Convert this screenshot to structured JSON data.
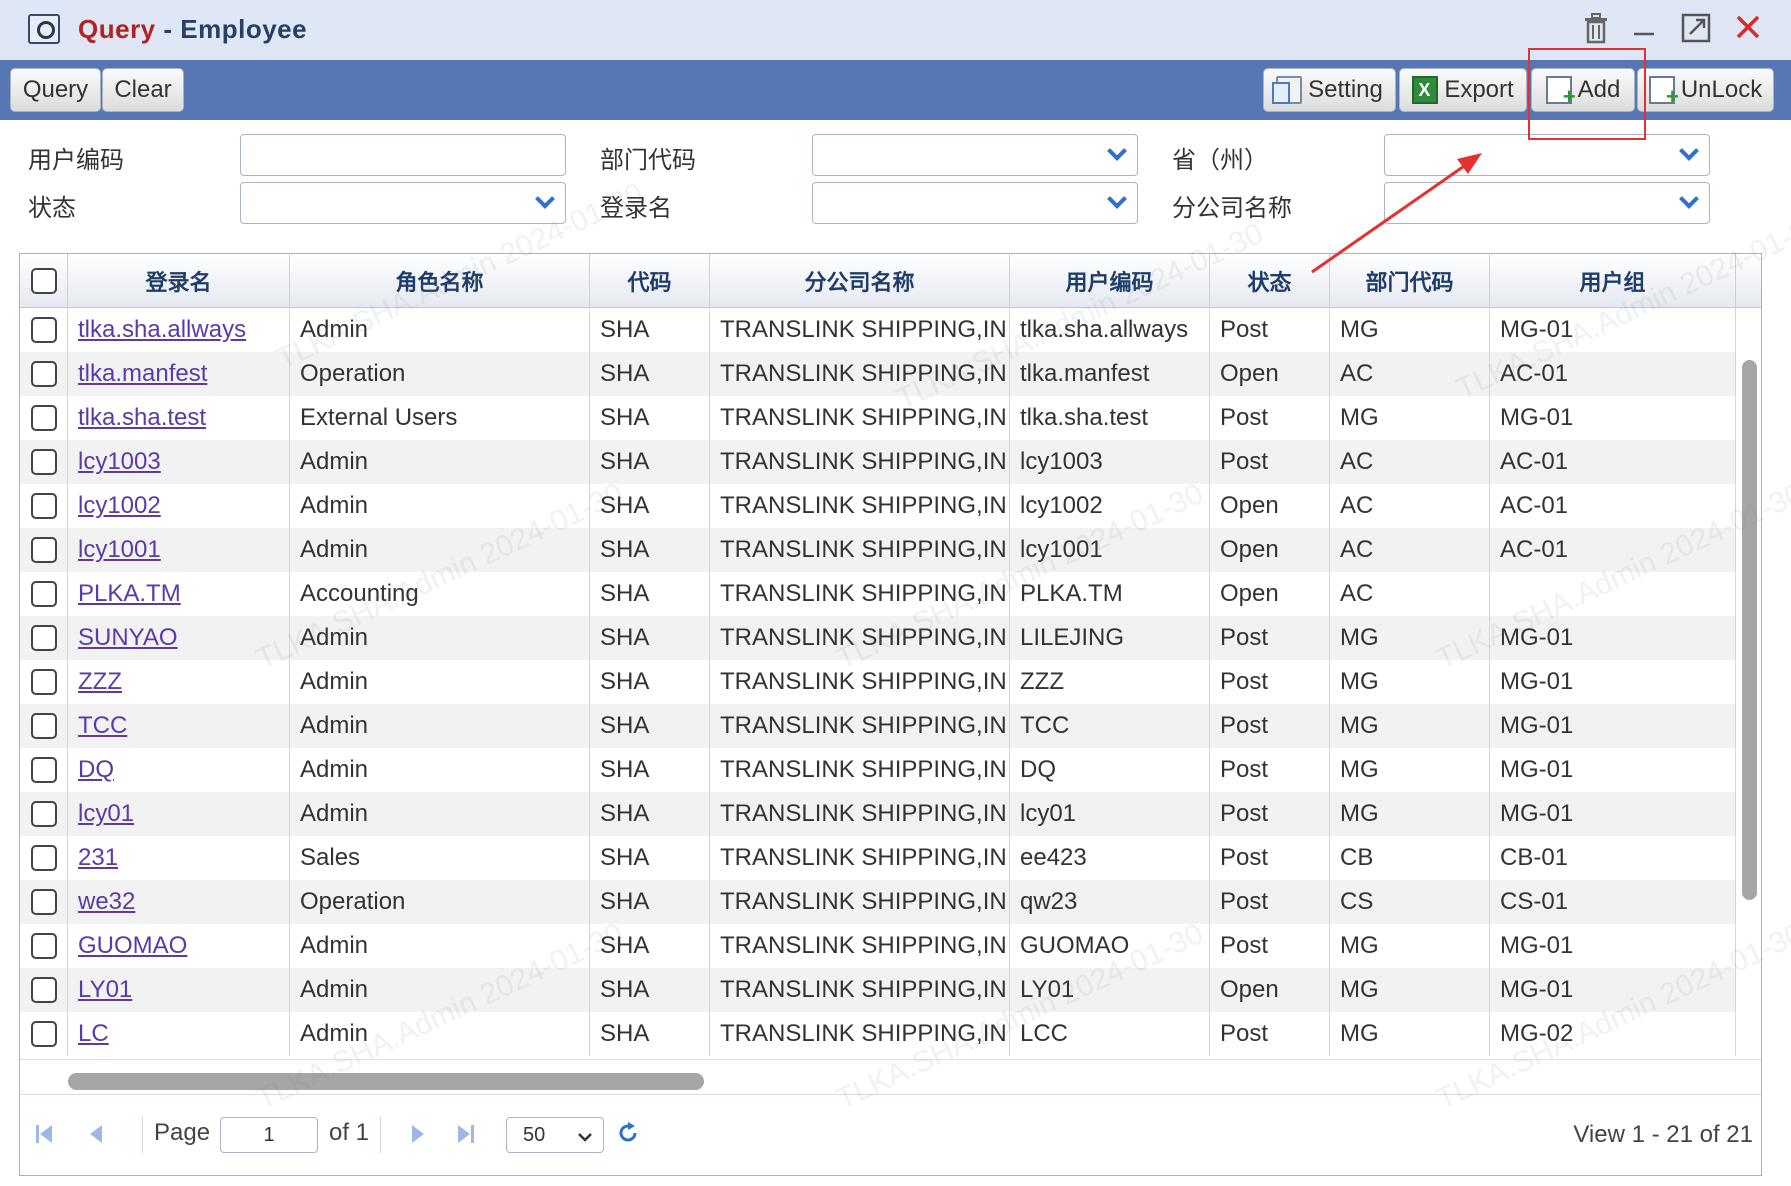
{
  "window": {
    "title_prefix": "Query",
    "title_sep": " - ",
    "title_name": "Employee",
    "controls": {
      "delete": "🗑",
      "minimize": "–",
      "maximize": "⤢",
      "close": "✕"
    }
  },
  "toolbar": {
    "query": "Query",
    "clear": "Clear",
    "setting": "Setting",
    "export": "Export",
    "add": "Add",
    "unlock": "UnLock"
  },
  "form": {
    "user_code": "用户编码",
    "dept_code": "部门代码",
    "province": "省（州）",
    "status": "状态",
    "login_name": "登录名",
    "branch_name": "分公司名称"
  },
  "grid": {
    "columns": [
      "登录名",
      "角色名称",
      "代码",
      "分公司名称",
      "用户编码",
      "状态",
      "部门代码",
      "用户组"
    ],
    "rows": [
      [
        "tlka.sha.allways",
        "Admin",
        "SHA",
        "TRANSLINK SHIPPING,IN",
        "tlka.sha.allways",
        "Post",
        "MG",
        "MG-01"
      ],
      [
        "tlka.manfest",
        "Operation",
        "SHA",
        "TRANSLINK SHIPPING,IN",
        "tlka.manfest",
        "Open",
        "AC",
        "AC-01"
      ],
      [
        "tlka.sha.test",
        "External Users",
        "SHA",
        "TRANSLINK SHIPPING,IN",
        "tlka.sha.test",
        "Post",
        "MG",
        "MG-01"
      ],
      [
        "lcy1003",
        "Admin",
        "SHA",
        "TRANSLINK SHIPPING,IN",
        "lcy1003",
        "Post",
        "AC",
        "AC-01"
      ],
      [
        "lcy1002",
        "Admin",
        "SHA",
        "TRANSLINK SHIPPING,IN",
        "lcy1002",
        "Open",
        "AC",
        "AC-01"
      ],
      [
        "lcy1001",
        "Admin",
        "SHA",
        "TRANSLINK SHIPPING,IN",
        "lcy1001",
        "Open",
        "AC",
        "AC-01"
      ],
      [
        "PLKA.TM",
        "Accounting",
        "SHA",
        "TRANSLINK SHIPPING,IN",
        "PLKA.TM",
        "Open",
        "AC",
        ""
      ],
      [
        "SUNYAO",
        "Admin",
        "SHA",
        "TRANSLINK SHIPPING,IN",
        "LILEJING",
        "Post",
        "MG",
        "MG-01"
      ],
      [
        "ZZZ",
        "Admin",
        "SHA",
        "TRANSLINK SHIPPING,IN",
        "ZZZ",
        "Post",
        "MG",
        "MG-01"
      ],
      [
        "TCC",
        "Admin",
        "SHA",
        "TRANSLINK SHIPPING,IN",
        "TCC",
        "Post",
        "MG",
        "MG-01"
      ],
      [
        "DQ",
        "Admin",
        "SHA",
        "TRANSLINK SHIPPING,IN",
        "DQ",
        "Post",
        "MG",
        "MG-01"
      ],
      [
        "lcy01",
        "Admin",
        "SHA",
        "TRANSLINK SHIPPING,IN",
        "lcy01",
        "Post",
        "MG",
        "MG-01"
      ],
      [
        "231",
        "Sales",
        "SHA",
        "TRANSLINK SHIPPING,IN",
        "ee423",
        "Post",
        "CB",
        "CB-01"
      ],
      [
        "we32",
        "Operation",
        "SHA",
        "TRANSLINK SHIPPING,IN",
        "qw23",
        "Post",
        "CS",
        "CS-01"
      ],
      [
        "GUOMAO",
        "Admin",
        "SHA",
        "TRANSLINK SHIPPING,IN",
        "GUOMAO",
        "Post",
        "MG",
        "MG-01"
      ],
      [
        "LY01",
        "Admin",
        "SHA",
        "TRANSLINK SHIPPING,IN",
        "LY01",
        "Open",
        "MG",
        "MG-01"
      ],
      [
        "LC",
        "Admin",
        "SHA",
        "TRANSLINK SHIPPING,IN",
        "LCC",
        "Post",
        "MG",
        "MG-02"
      ]
    ]
  },
  "pager": {
    "page_label": "Page",
    "page_value": "1",
    "of_label": "of 1",
    "page_size": "50",
    "page_size_options": [
      "50"
    ],
    "view_text": "View 1 - 21 of 21"
  },
  "watermark": "TLKA.SHA.Admin 2024-01-30",
  "colors": {
    "toolbar": "#5677b3",
    "title_red": "#b22222",
    "link": "#5a3aa8",
    "highlight": "#e53030"
  }
}
